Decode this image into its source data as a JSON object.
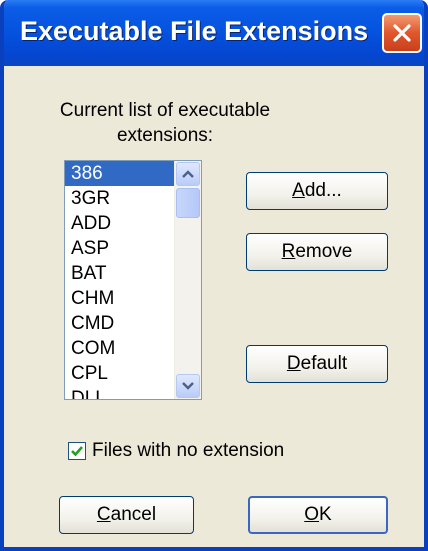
{
  "window": {
    "title": "Executable File Extensions",
    "close_icon": "close-icon"
  },
  "list_caption": {
    "line1": "Current list of executable",
    "line2": "extensions:"
  },
  "extensions": [
    "386",
    "3GR",
    "ADD",
    "ASP",
    "BAT",
    "CHM",
    "CMD",
    "COM",
    "CPL",
    "DLL"
  ],
  "selected_index": 0,
  "buttons": {
    "add_mnemonic": "A",
    "add_rest": "dd...",
    "remove_mnemonic": "R",
    "remove_rest": "emove",
    "default_mnemonic": "D",
    "default_rest": "efault",
    "cancel_mnemonic": "C",
    "cancel_rest": "ancel",
    "ok_mnemonic": "O",
    "ok_rest": "K"
  },
  "checkbox": {
    "label": "Files with no extension",
    "checked": true
  },
  "colors": {
    "title_bar": "#0554e0",
    "selection": "#316ac5",
    "dialog_bg": "#ece9d8"
  }
}
